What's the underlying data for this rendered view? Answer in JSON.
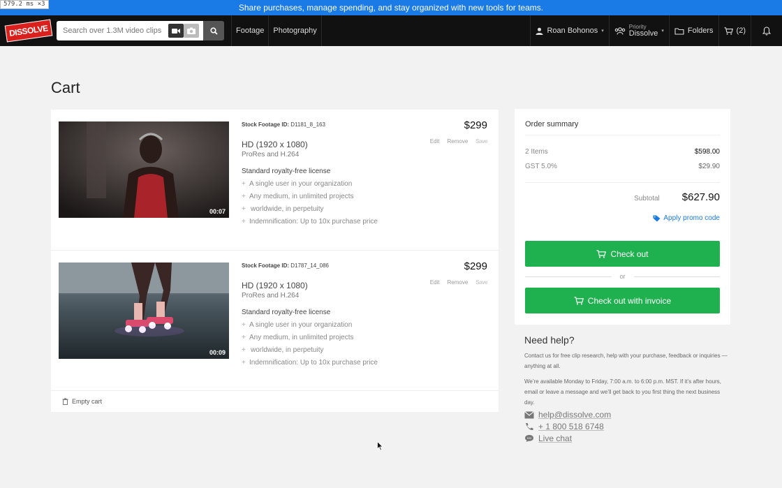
{
  "perf": {
    "label": "579.2 ms ×3"
  },
  "banner": {
    "text": "Share purchases, manage spending, and stay organized with new tools for teams."
  },
  "nav": {
    "logo_text": "DISSOLVE",
    "search_placeholder": "Search over 1.3M video clips",
    "links": [
      "Footage",
      "Photography"
    ],
    "user_name": "Roan Bohonos",
    "priority_label": "Priority",
    "priority_name": "Dissolve",
    "folders_label": "Folders",
    "cart_count": "(2)"
  },
  "page": {
    "title": "Cart"
  },
  "cart": {
    "items": [
      {
        "stock_label": "Stock Footage ID:",
        "stock_id": "D1181_8_163",
        "price": "$299",
        "format": "HD (1920 x 1080)",
        "codec": "ProRes and H.264",
        "edit": "Edit",
        "remove": "Remove",
        "save": "Save",
        "license_title": "Standard royalty-free license",
        "license_points": [
          "A single user in your organization",
          "Any medium, in unlimited projects",
          "Indemnification: Up to 10x purchase price"
        ],
        "license_cont": "worldwide, in perpetuity",
        "duration": "00:07"
      },
      {
        "stock_label": "Stock Footage ID:",
        "stock_id": "D1787_14_086",
        "price": "$299",
        "format": "HD (1920 x 1080)",
        "codec": "ProRes and H.264",
        "edit": "Edit",
        "remove": "Remove",
        "save": "Save",
        "license_title": "Standard royalty-free license",
        "license_points": [
          "A single user in your organization",
          "Any medium, in unlimited projects",
          "Indemnification: Up to 10x purchase price"
        ],
        "license_cont": "worldwide, in perpetuity",
        "duration": "00:09"
      }
    ],
    "empty_label": "Empty cart"
  },
  "summary": {
    "title": "Order summary",
    "items_label": "2 Items",
    "items_value": "$598.00",
    "tax_label": "GST 5.0%",
    "tax_value": "$29.90",
    "subtotal_label": "Subtotal",
    "subtotal_value": "$627.90",
    "promo": "Apply promo code",
    "checkout": "Check out",
    "or": "or",
    "checkout_invoice": "Check out with invoice"
  },
  "help": {
    "title": "Need help?",
    "para1": "Contact us for free clip research, help with your purchase, feedback or inquiries — anything at all.",
    "para2": "We’re available Monday to Friday, 7:00 a.m. to 6:00 p.m. MST. If it’s after hours, email or leave a message and we’ll get back to you first thing the next business day.",
    "email": "help@dissolve.com",
    "phone": "+ 1 800 518 6748",
    "chat": "Live chat"
  },
  "colors": {
    "banner": "#1a7ae6",
    "checkout": "#1fb04f",
    "logo": "#d9201c",
    "link": "#1a7ae6"
  }
}
